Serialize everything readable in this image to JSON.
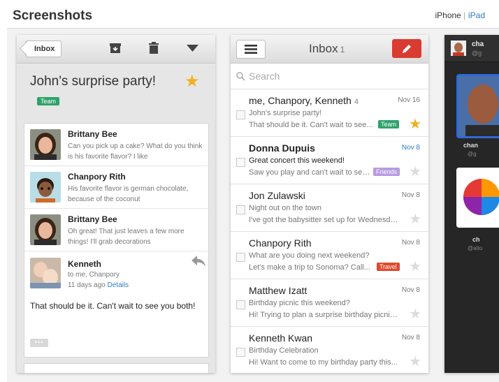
{
  "header": {
    "title": "Screenshots",
    "tab_iphone": "iPhone",
    "tab_separator": "|",
    "tab_ipad": "iPad"
  },
  "thread_view": {
    "back_label": "Inbox",
    "subject": "John's surprise party!",
    "label": "Team",
    "label_color": "#2fa26a",
    "star_color": "#f2b01e",
    "messages": [
      {
        "name": "Brittany Bee",
        "snippet": "Can you pick up a cake? What do you think is his favorite flavor? I like"
      },
      {
        "name": "Chanpory Rith",
        "snippet": "His favorite flavor is german chocolate, because of the coconut"
      },
      {
        "name": "Brittany Bee",
        "snippet": "Oh great! That just leaves a few more things! I'll grab decorations"
      }
    ],
    "expanded": {
      "name": "Kenneth",
      "to": "to me, Chanpory",
      "date": "11 days ago",
      "details_link": "Details",
      "body": "That should be it. Can't wait to see you both!",
      "more": "•••"
    }
  },
  "inbox_view": {
    "title": "Inbox",
    "count": "1",
    "search_placeholder": "Search",
    "compose_color": "#d93b32",
    "rows": [
      {
        "from": "me, Chanpory, Kenneth",
        "thread_count": "4",
        "date": "Nov 16",
        "subject": "John's surprise party!",
        "snippet": "That should be it. Can't wait to see...",
        "label": "Team",
        "label_color": "#2fa26a",
        "starred": true,
        "unread": false
      },
      {
        "from": "Donna Dupuis",
        "thread_count": "",
        "date": "Nov 8",
        "subject": "Great concert this weekend!",
        "snippet": "Saw you play and can't wait to see...",
        "label": "Friends",
        "label_color": "#b79ae0",
        "starred": false,
        "unread": true
      },
      {
        "from": "Jon Zulawski",
        "thread_count": "",
        "date": "Nov 8",
        "subject": "Night out on the town",
        "snippet": "I've got the babysitter set up for Wednesday...",
        "label": "",
        "label_color": "",
        "starred": false,
        "unread": false
      },
      {
        "from": "Chanpory Rith",
        "thread_count": "",
        "date": "Nov 8",
        "subject": "What are you doing next weekend?",
        "snippet": "Let's make a trip to Sonoma? Call...",
        "label": "Travel",
        "label_color": "#e0492e",
        "starred": false,
        "unread": false
      },
      {
        "from": "Matthew Izatt",
        "thread_count": "",
        "date": "Nov 8",
        "subject": "Birthday picnic this weekend?",
        "snippet": "Hi! Trying to plan a surprise birthday picnic...",
        "label": "",
        "label_color": "",
        "starred": false,
        "unread": false
      },
      {
        "from": "Kenneth Kwan",
        "thread_count": "",
        "date": "Nov 8",
        "subject": "Birthday Celebration",
        "snippet": "Hi! Want to come to my birthday party this...",
        "label": "",
        "label_color": "",
        "starred": false,
        "unread": false
      }
    ]
  },
  "contacts_view": {
    "top_name": "cha",
    "top_sub": "@g",
    "card_name": "chan",
    "card_sub": "@g",
    "card2_name": "ch",
    "card2_sub": "@alto"
  }
}
